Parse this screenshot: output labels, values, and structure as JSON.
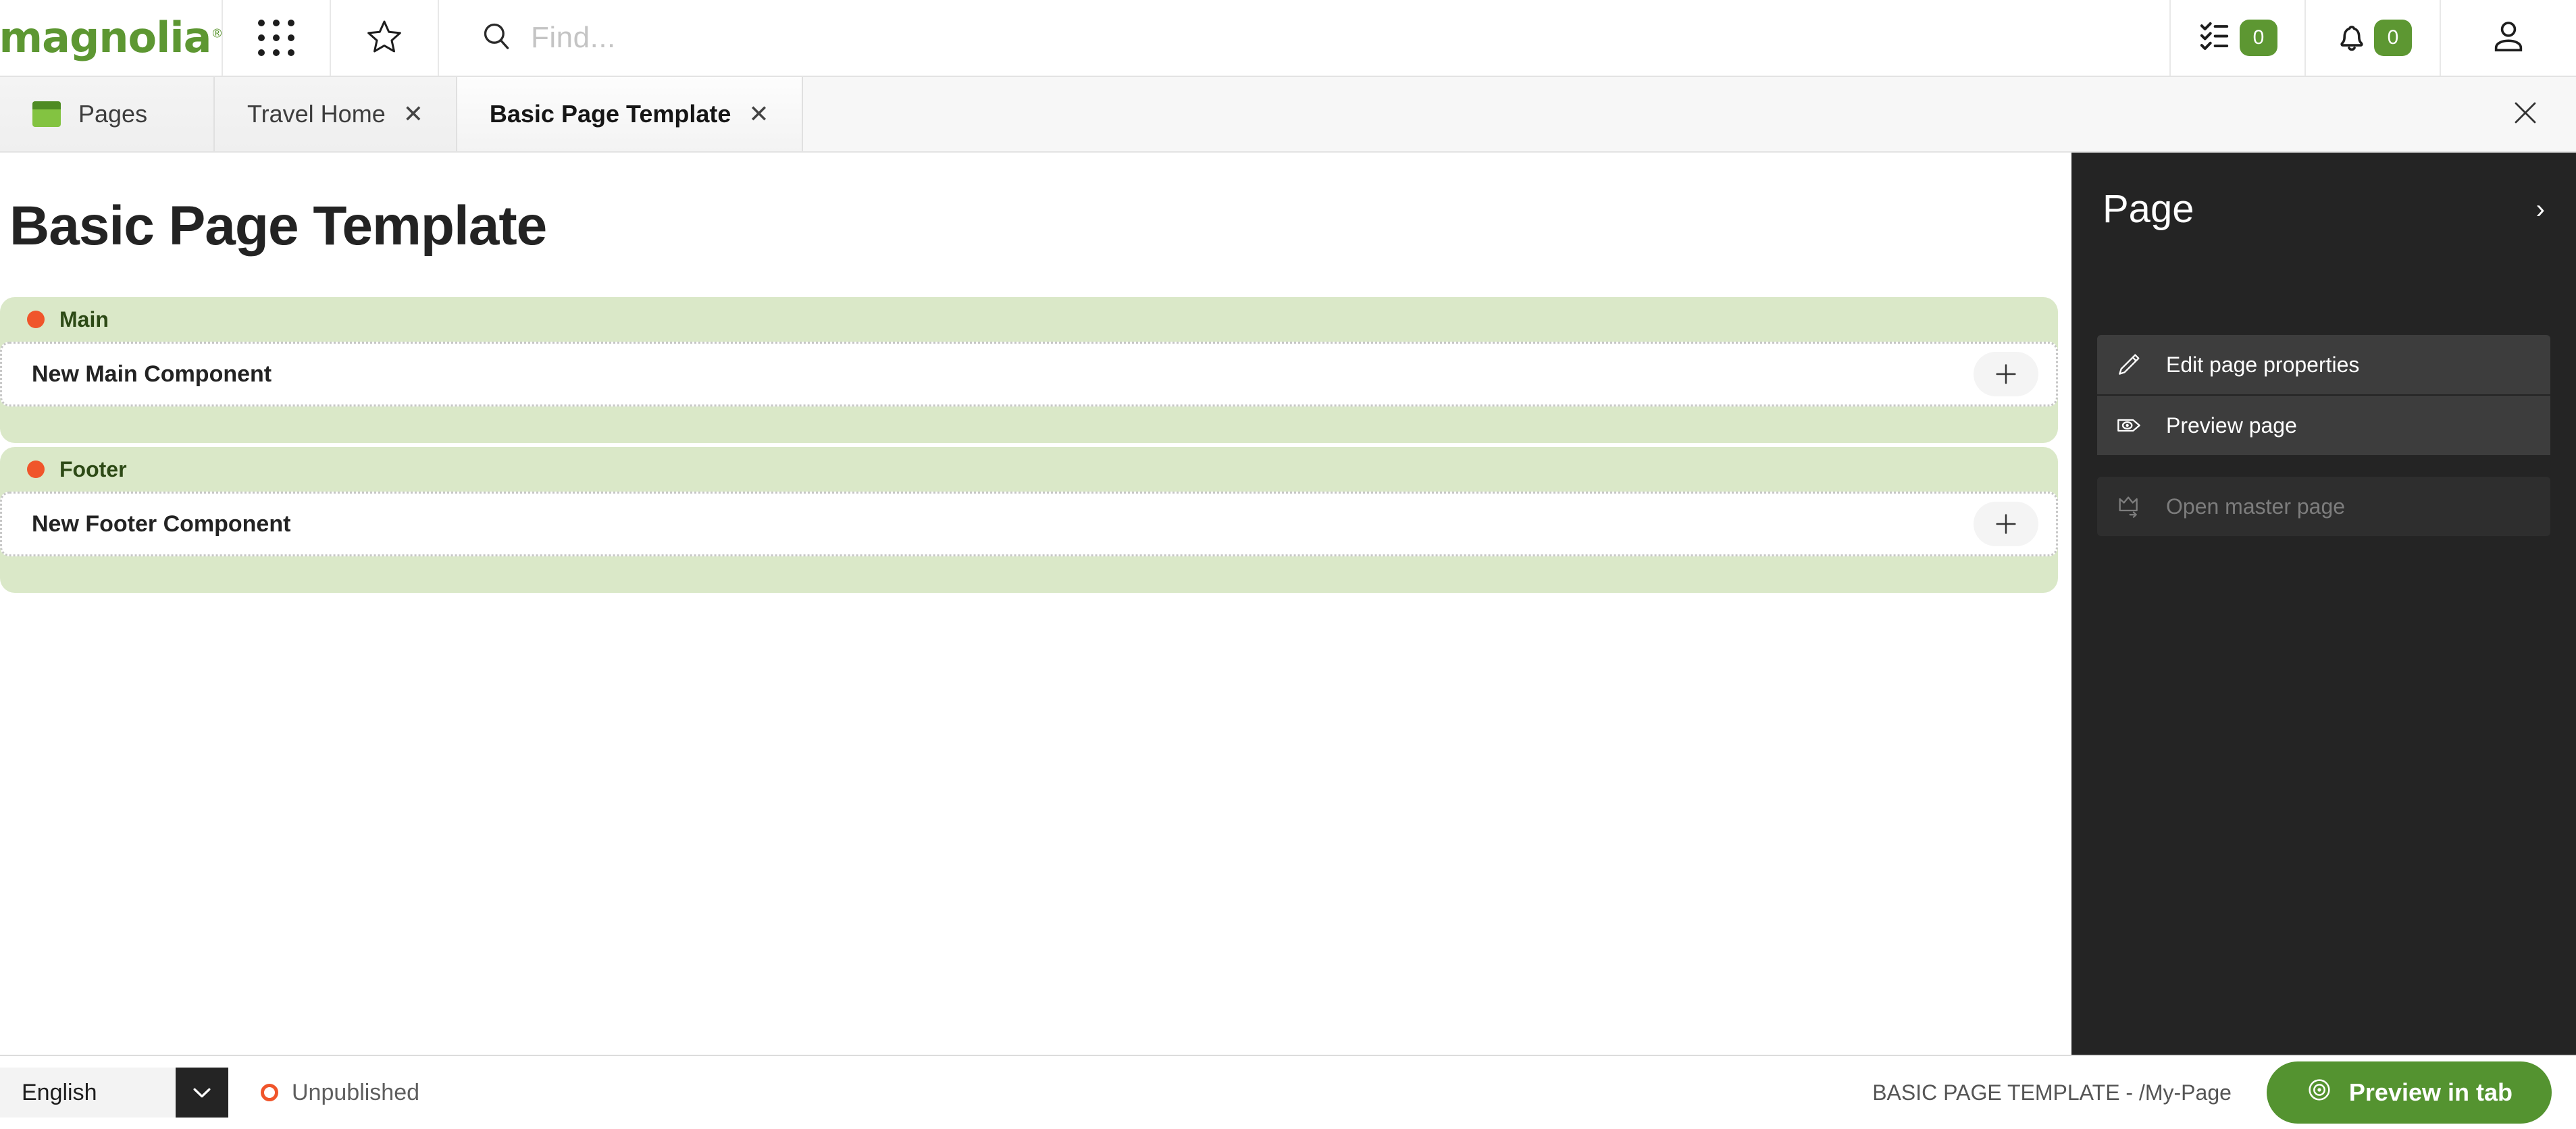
{
  "header": {
    "logo_text": "magnolia",
    "logo_mark": "®",
    "apps_icon": "grid-apps-icon",
    "favorites_icon": "star-icon",
    "search": {
      "icon": "search-icon",
      "placeholder": "Find...",
      "value": ""
    },
    "tasks": {
      "icon": "tasks-checklist-icon",
      "count": "0"
    },
    "notifications": {
      "icon": "bell-icon",
      "count": "0"
    },
    "user": {
      "icon": "user-avatar-icon"
    }
  },
  "tabbar": {
    "tabs": [
      {
        "label": "Pages",
        "icon": "pages-app-icon",
        "active": false,
        "closable": false
      },
      {
        "label": "Travel Home",
        "icon": "",
        "active": false,
        "closable": true
      },
      {
        "label": "Basic Page Template",
        "icon": "",
        "active": true,
        "closable": true
      }
    ],
    "close_all_icon": "close-icon",
    "close_glyph": "✕"
  },
  "canvas": {
    "page_title": "Basic Page Template",
    "areas": [
      {
        "label": "Main",
        "dot_color": "#f0552b",
        "components": [
          {
            "label": "New Main Component",
            "add_icon": "plus-icon"
          }
        ]
      },
      {
        "label": "Footer",
        "dot_color": "#f0552b",
        "components": [
          {
            "label": "New Footer Component",
            "add_icon": "plus-icon"
          }
        ]
      }
    ]
  },
  "right_panel": {
    "title": "Page",
    "collapse_icon": "chevron-right-icon",
    "collapse_glyph": "›",
    "actions": [
      {
        "label": "Edit page properties",
        "icon": "pencil-edit-icon",
        "disabled": false
      },
      {
        "label": "Preview page",
        "icon": "eye-preview-icon",
        "disabled": false
      },
      {
        "label": "Open master page",
        "icon": "master-page-icon",
        "disabled": true
      }
    ]
  },
  "bottombar": {
    "language": {
      "value": "English",
      "icon": "chevron-down-icon"
    },
    "status": {
      "label": "Unpublished",
      "color": "#f0552b"
    },
    "template_path": "BASIC PAGE TEMPLATE - /My-Page",
    "preview_button": {
      "label": "Preview in tab",
      "icon": "eye-circle-icon"
    }
  },
  "colors": {
    "brand_green": "#5d9732",
    "area_green": "#dae8c8",
    "panel_dark": "#242424",
    "accent_orange": "#f0552b"
  }
}
